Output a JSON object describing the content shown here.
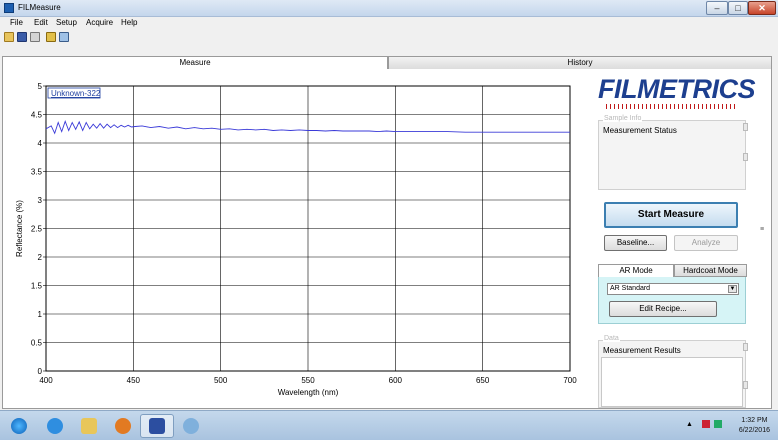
{
  "window": {
    "title": "FILMeasure",
    "controls": {
      "minimize": "–",
      "maximize": "□",
      "close": "✕"
    }
  },
  "menu": [
    "File",
    "Edit",
    "Setup",
    "Acquire",
    "Help"
  ],
  "toolbar_icons": [
    "open-icon",
    "save-icon",
    "print-icon",
    "settings-icon",
    "copy-icon"
  ],
  "tabs": {
    "measure": "Measure",
    "history": "History"
  },
  "chart_data": {
    "type": "line",
    "xlabel": "Wavelength (nm)",
    "ylabel": "Reflectance (%)",
    "legend": "Unknown-322",
    "legend_position": "top-left",
    "xlim": [
      400,
      700
    ],
    "ylim": [
      0,
      5
    ],
    "xticks": [
      "400",
      "450",
      "500",
      "550",
      "600",
      "650",
      "700"
    ],
    "yticks": [
      "0",
      "0.5",
      "1",
      "1.5",
      "2",
      "2.5",
      "3",
      "3.5",
      "4",
      "4.5",
      "5"
    ],
    "grid": true,
    "series": [
      {
        "name": "Unknown-322",
        "color": "#3a3ad8",
        "x": [
          400,
          403,
          405,
          407,
          409,
          411,
          413,
          415,
          417,
          419,
          421,
          423,
          425,
          427,
          429,
          431,
          433,
          435,
          437,
          439,
          441,
          443,
          445,
          447,
          449,
          451,
          455,
          460,
          465,
          470,
          475,
          480,
          485,
          490,
          495,
          500,
          505,
          510,
          515,
          520,
          525,
          530,
          535,
          540,
          545,
          550,
          555,
          560,
          565,
          570,
          575,
          580,
          585,
          590,
          595,
          600,
          610,
          620,
          630,
          640,
          650,
          660,
          670,
          680,
          690,
          700
        ],
        "y": [
          4.25,
          4.3,
          4.17,
          4.36,
          4.2,
          4.38,
          4.22,
          4.36,
          4.24,
          4.37,
          4.22,
          4.36,
          4.25,
          4.33,
          4.26,
          4.34,
          4.26,
          4.33,
          4.27,
          4.32,
          4.27,
          4.31,
          4.28,
          4.31,
          4.28,
          4.29,
          4.3,
          4.27,
          4.29,
          4.26,
          4.28,
          4.25,
          4.27,
          4.25,
          4.26,
          4.24,
          4.25,
          4.23,
          4.24,
          4.23,
          4.24,
          4.22,
          4.23,
          4.22,
          4.23,
          4.22,
          4.22,
          4.21,
          4.22,
          4.21,
          4.21,
          4.21,
          4.21,
          4.2,
          4.21,
          4.2,
          4.2,
          4.2,
          4.2,
          4.19,
          4.19,
          4.19,
          4.19,
          4.19,
          4.19,
          4.19
        ]
      }
    ]
  },
  "logo": {
    "text": "FILMETRICS",
    "color": "#1d3f8f"
  },
  "sample_info": {
    "ghost_label": "Sample Info",
    "status_label": "Measurement Status"
  },
  "actions": {
    "start": "Start Measure",
    "baseline": "Baseline...",
    "analyze": "Analyze"
  },
  "mode": {
    "tabs": [
      "AR Mode",
      "Hardcoat Mode"
    ],
    "selected": "AR Standard",
    "edit_recipe": "Edit Recipe..."
  },
  "results": {
    "ghost_label": "Data",
    "label": "Measurement Results"
  },
  "taskbar": {
    "items": [
      "start-orb-icon",
      "internet-explorer-icon",
      "file-explorer-icon",
      "media-player-icon",
      "filmeasure-app-icon",
      "paint-icon"
    ],
    "time": "1:32 PM",
    "date": "6/22/2016"
  }
}
